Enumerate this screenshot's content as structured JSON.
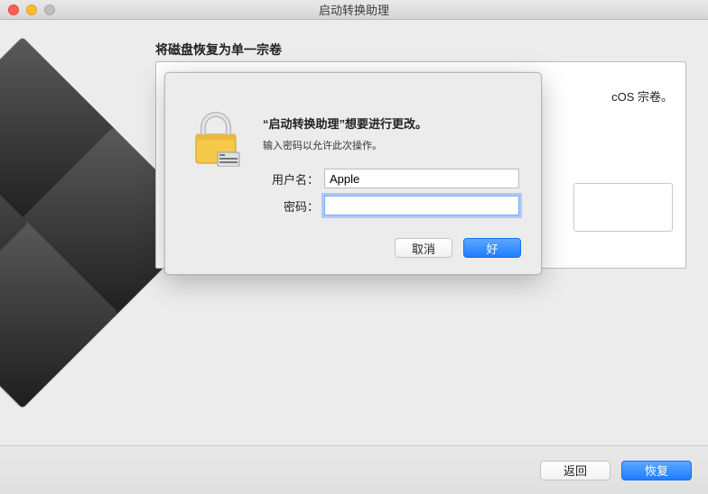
{
  "window": {
    "title": "启动转换助理"
  },
  "main": {
    "heading": "将磁盘恢复为单一宗卷",
    "partial_text": "cOS 宗卷。"
  },
  "footer": {
    "back_label": "返回",
    "restore_label": "恢复"
  },
  "dialog": {
    "title": "“启动转换助理”想要进行更改。",
    "subtitle": "输入密码以允许此次操作。",
    "username_label": "用户名：",
    "password_label": "密码：",
    "username_value": "Apple",
    "password_value": "",
    "cancel_label": "取消",
    "ok_label": "好"
  }
}
